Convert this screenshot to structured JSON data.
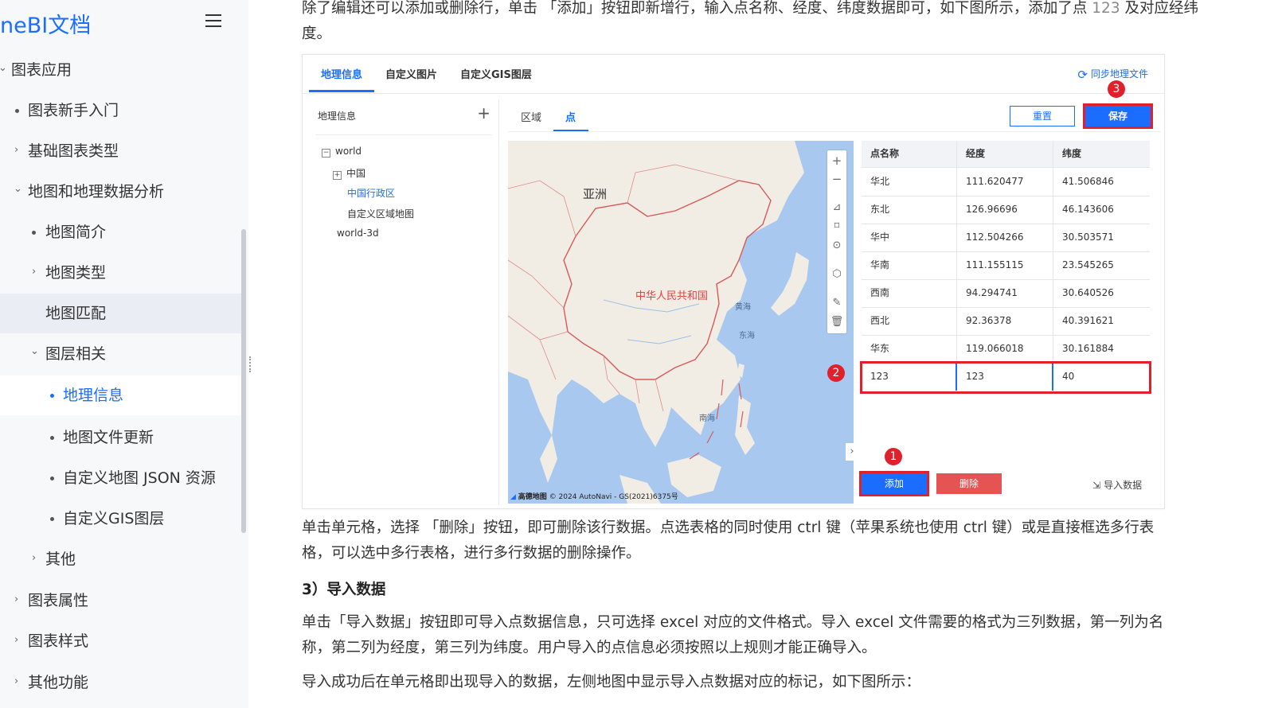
{
  "sidebar": {
    "logo": "neBI文档",
    "items": [
      {
        "label": "图表应用",
        "arrow": "⌄"
      },
      {
        "label": "图表新手入门"
      },
      {
        "label": "基础图表类型",
        "arrow": "›"
      },
      {
        "label": "地图和地理数据分析",
        "arrow": "⌄"
      },
      {
        "label": "地图简介"
      },
      {
        "label": "地图类型",
        "arrow": "›"
      },
      {
        "label": "地图匹配"
      },
      {
        "label": "图层相关",
        "arrow": "⌄"
      },
      {
        "label": "地理信息"
      },
      {
        "label": "地图文件更新"
      },
      {
        "label": "自定义地图 JSON 资源"
      },
      {
        "label": "自定义GIS图层"
      },
      {
        "label": "其他",
        "arrow": "›"
      },
      {
        "label": "图表属性",
        "arrow": "›"
      },
      {
        "label": "图表样式",
        "arrow": "›"
      },
      {
        "label": "其他功能",
        "arrow": "›"
      }
    ]
  },
  "content": {
    "para1_a": "除了编辑还可以添加或删除行，单击 「添加」按钮即新增行，输入点名称、经度、纬度数据即可，如下图所示，添加了点 ",
    "para1_code": "123",
    "para1_b": " 及对应经纬度。",
    "para2": "单击单元格，选择 「删除」按钮，即可删除该行数据。点选表格的同时使用 ctrl 键（苹果系统也使用 ctrl 键）或是直接框选多行表格，可以选中多行表格，进行多行数据的删除操作。",
    "heading3": "3）导入数据",
    "para3": "单击「导入数据」按钮即可导入点数据信息，只可选择 excel 对应的文件格式。导入 excel 文件需要的格式为三列数据，第一列为名称，第二列为经度，第三列为纬度。用户导入的点信息必须按照以上规则才能正确导入。",
    "para4": "导入成功后在单元格即出现导入的数据，左侧地图中显示导入点数据对应的标记，如下图所示："
  },
  "shot": {
    "top_tabs": [
      "地理信息",
      "自定义图片",
      "自定义GIS图层"
    ],
    "sync_label": "同步地理文件",
    "geo_title": "地理信息",
    "plus": "+",
    "tree": {
      "world": "world",
      "china": "中国",
      "china_admin": "中国行政区",
      "custom_area": "自定义区域地图",
      "world3d": "world-3d"
    },
    "sub_tabs": [
      "区域",
      "点"
    ],
    "reset_label": "重置",
    "save_label": "保存",
    "add_label": "添加",
    "delete_label": "删除",
    "import_label": "导入数据",
    "badges": [
      "1",
      "2",
      "3"
    ],
    "map": {
      "label_asia": "亚洲",
      "label_prc": "中华人民共和国",
      "label_yellow_sea": "黄海",
      "label_east_sea": "东海",
      "label_south_sea": "南海",
      "attribution_brand": "高德地图",
      "attribution": "© 2024 AutoNavi - GS(2021)6375号"
    },
    "table": {
      "headers": [
        "点名称",
        "经度",
        "纬度"
      ],
      "rows": [
        [
          "华北",
          "111.620477",
          "41.506846"
        ],
        [
          "东北",
          "126.96696",
          "46.143606"
        ],
        [
          "华中",
          "112.504266",
          "30.503571"
        ],
        [
          "华南",
          "111.155115",
          "23.545265"
        ],
        [
          "西南",
          "94.294741",
          "30.640526"
        ],
        [
          "西北",
          "92.36378",
          "40.391621"
        ],
        [
          "华东",
          "119.066018",
          "30.161884"
        ],
        [
          "123",
          "123",
          "40"
        ]
      ]
    }
  }
}
